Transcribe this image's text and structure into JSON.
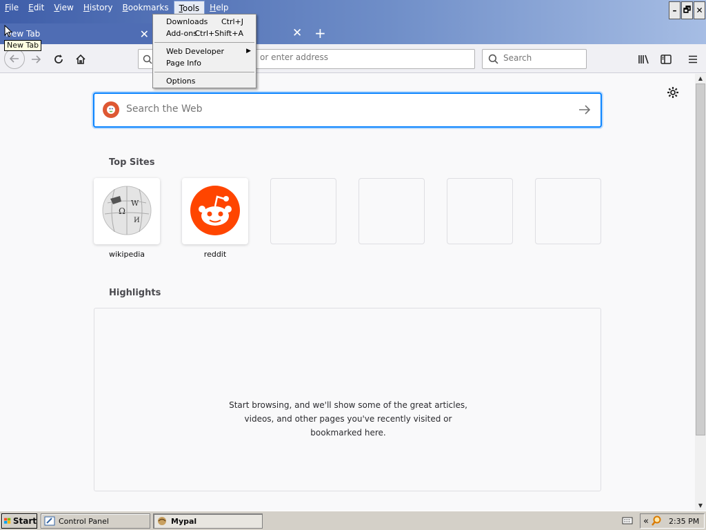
{
  "window": {
    "menu": [
      {
        "label": "File",
        "u": "F",
        "rest": "ile"
      },
      {
        "label": "Edit",
        "u": "E",
        "rest": "dit"
      },
      {
        "label": "View",
        "u": "V",
        "rest": "iew"
      },
      {
        "label": "History",
        "u": "H",
        "rest": "istory",
        "pre": ""
      },
      {
        "label": "Bookmarks",
        "u": "B",
        "rest": "ookmarks"
      },
      {
        "label": "Tools",
        "u": "T",
        "rest": "ools"
      },
      {
        "label": "Help",
        "u": "H",
        "rest": "elp"
      }
    ],
    "controls": {
      "minimize": "–",
      "restore": "🗗",
      "close": "✕"
    }
  },
  "tabs": {
    "active_label": "New Tab",
    "close_glyph": "✕",
    "second_close_glyph": "✕",
    "new_tab_glyph": "+",
    "tooltip": "New Tab"
  },
  "navbar": {
    "url_placeholder": "or enter address",
    "search_placeholder": "Search"
  },
  "tools_menu": {
    "items": [
      {
        "label": "Downloads",
        "shortcut": "Ctrl+J"
      },
      {
        "label": "Add-ons",
        "shortcut": "Ctrl+Shift+A"
      },
      {
        "label": "Web Developer",
        "submenu": "▶"
      },
      {
        "label": "Page Info",
        "shortcut": ""
      },
      {
        "label": "Options",
        "shortcut": ""
      }
    ]
  },
  "newtab_page": {
    "search_placeholder": "Search the Web",
    "top_sites_title": "Top Sites",
    "top_sites": [
      {
        "label": "wikipedia",
        "icon": "wikipedia-icon"
      },
      {
        "label": "reddit",
        "icon": "reddit-icon"
      },
      {
        "label": "",
        "icon": ""
      },
      {
        "label": "",
        "icon": ""
      },
      {
        "label": "",
        "icon": ""
      },
      {
        "label": "",
        "icon": ""
      }
    ],
    "highlights_title": "Highlights",
    "highlights_message": "Start browsing, and we'll show some of the great articles, videos, and other pages you've recently visited or bookmarked here."
  },
  "taskbar": {
    "start_label": "Start",
    "items": [
      {
        "label": "Control Panel"
      },
      {
        "label": "Mypal"
      }
    ],
    "tray_chevron": "«",
    "clock": "2:35 PM"
  },
  "colors": {
    "accent": "#0a84ff",
    "reddit": "#ff4500",
    "duckduckgo": "#de5833"
  }
}
